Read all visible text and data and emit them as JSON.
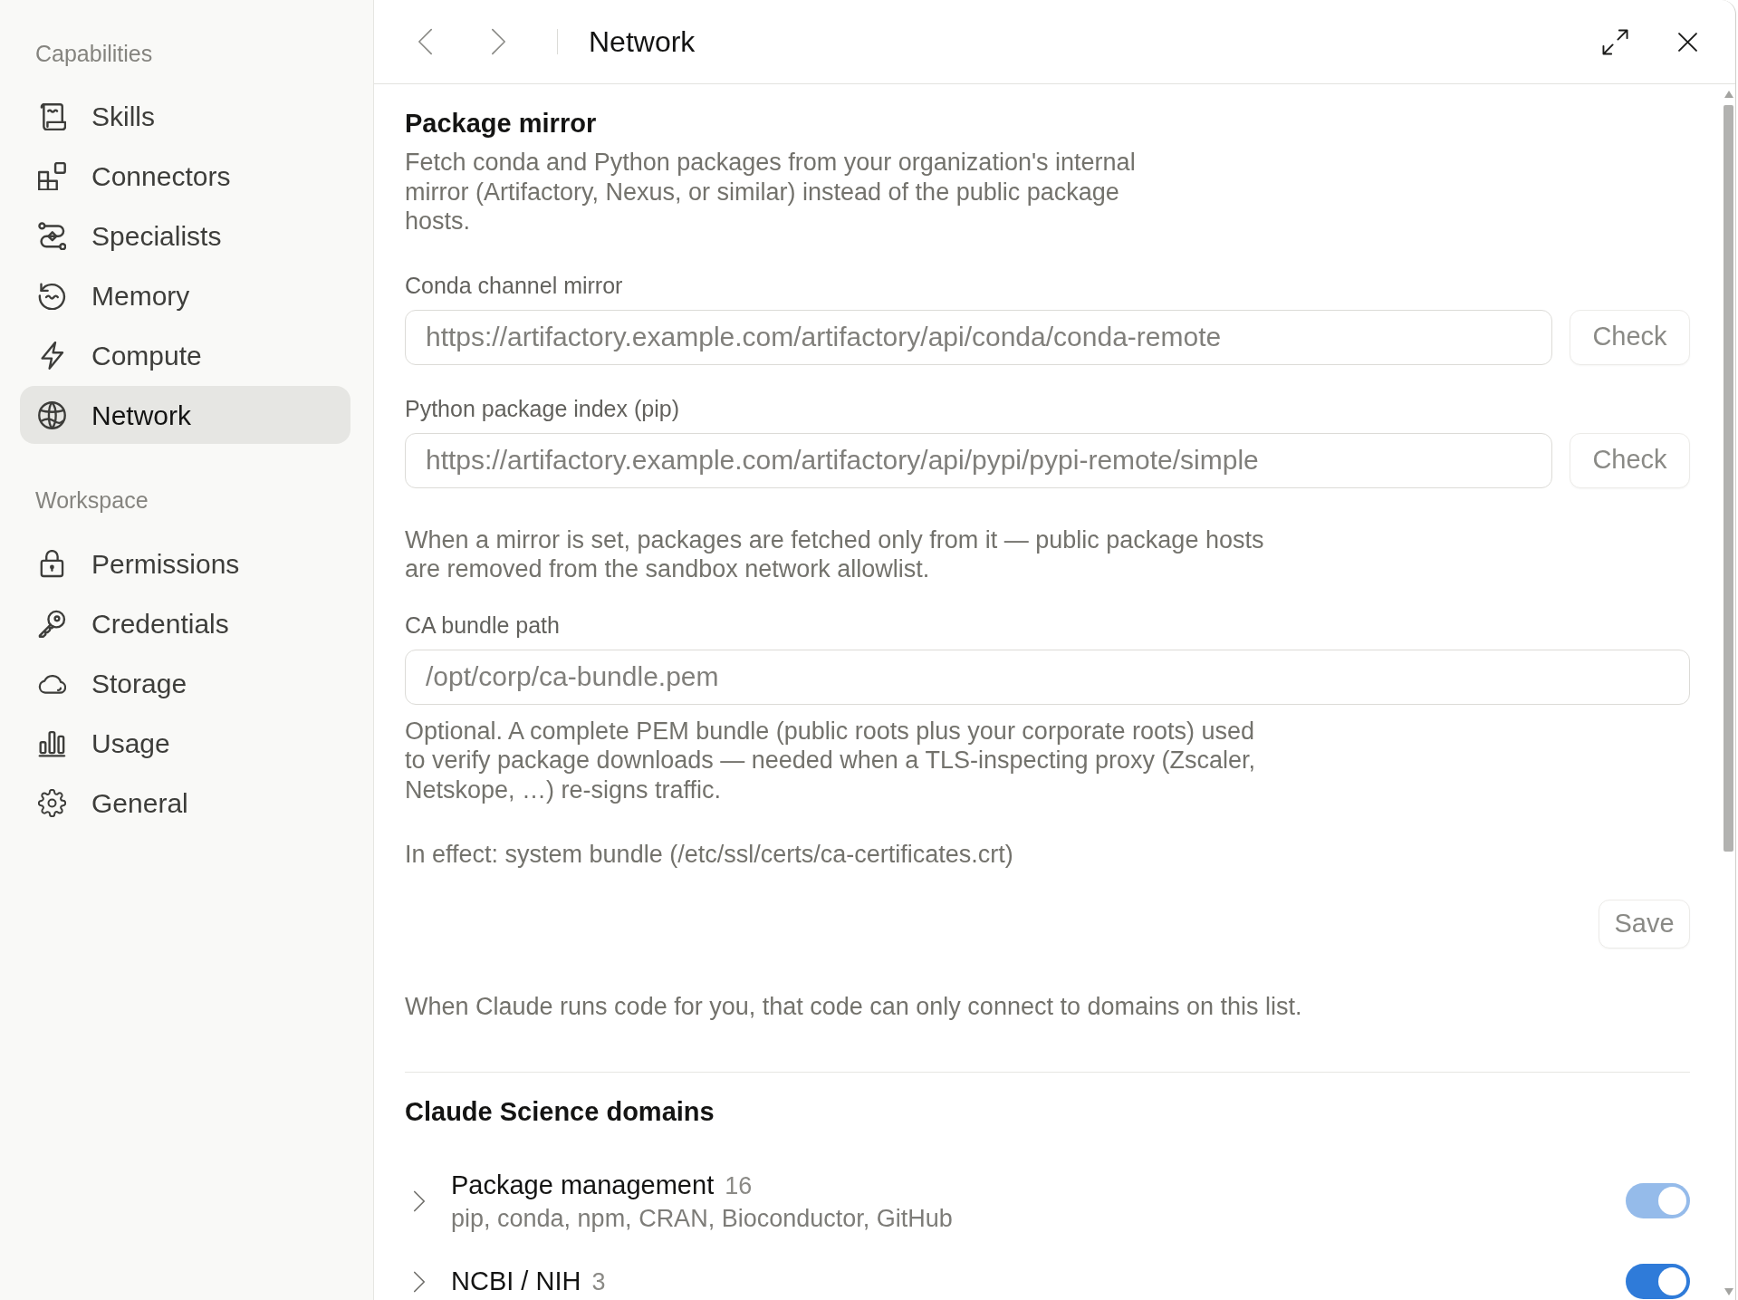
{
  "sidebar": {
    "sections": [
      {
        "heading": "Capabilities",
        "items": [
          {
            "label": "Skills",
            "selected": false
          },
          {
            "label": "Connectors",
            "selected": false
          },
          {
            "label": "Specialists",
            "selected": false
          },
          {
            "label": "Memory",
            "selected": false
          },
          {
            "label": "Compute",
            "selected": false
          },
          {
            "label": "Network",
            "selected": true
          }
        ]
      },
      {
        "heading": "Workspace",
        "items": [
          {
            "label": "Permissions",
            "selected": false
          },
          {
            "label": "Credentials",
            "selected": false
          },
          {
            "label": "Storage",
            "selected": false
          },
          {
            "label": "Usage",
            "selected": false
          },
          {
            "label": "General",
            "selected": false
          }
        ]
      }
    ]
  },
  "header": {
    "title": "Network"
  },
  "package_mirror": {
    "title": "Package mirror",
    "description": "Fetch conda and Python packages from your organization's internal mirror (Artifactory, Nexus, or similar) instead of the public package hosts.",
    "mirrors": [
      {
        "label": "Conda channel mirror",
        "placeholder": "https://artifactory.example.com/artifactory/api/conda/conda-remote",
        "button": "Check"
      },
      {
        "label": "Python package index (pip)",
        "placeholder": "https://artifactory.example.com/artifactory/api/pypi/pypi-remote/simple",
        "button": "Check"
      }
    ],
    "note": "When a mirror is set, packages are fetched only from it — public package hosts are removed from the sandbox network allowlist.",
    "ca_bundle": {
      "label": "CA bundle path",
      "placeholder": "/opt/corp/ca-bundle.pem",
      "help": "Optional. A complete PEM bundle (public roots plus your corporate roots) used to verify package downloads — needed when a TLS-inspecting proxy (Zscaler, Netskope, …) re-signs traffic.",
      "status": "In effect: system bundle (/etc/ssl/certs/ca-certificates.crt)"
    },
    "save_button": "Save"
  },
  "allowlist_note": "When Claude runs code for you, that code can only connect to domains on this list.",
  "domains": {
    "title": "Claude Science domains",
    "groups": [
      {
        "name": "Package management",
        "count": "16",
        "description": "pip, conda, npm, CRAN, Bioconductor, GitHub",
        "expanded": false,
        "on": true,
        "disabled": true
      },
      {
        "name": "NCBI / NIH",
        "count": "3",
        "expanded": false,
        "on": true,
        "disabled": false
      }
    ]
  }
}
